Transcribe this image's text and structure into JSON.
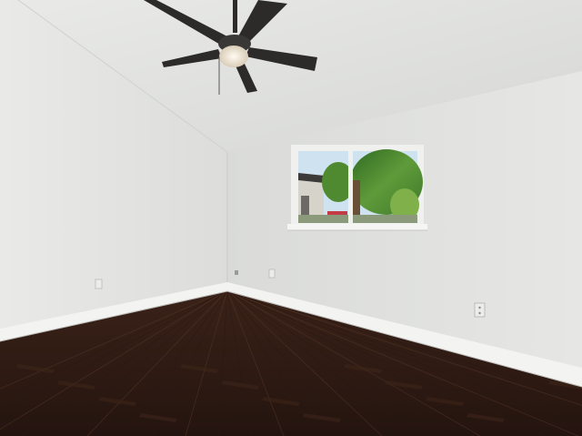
{
  "scene": {
    "subject": "empty-room",
    "colors": {
      "ceiling": "#e3e4e2",
      "ceiling_shadow": "#d4d5d3",
      "left_wall": "#e6e7e5",
      "back_wall": "#e1e2e0",
      "baseboard": "#f3f3f1",
      "floor_dark": "#2a1812",
      "floor_mid": "#3d2419",
      "floor_light": "#5a3827",
      "fan_blade": "#2d2b2a",
      "fan_light": "#f4ede0",
      "window_frame": "#f0f0ee",
      "foliage": "#3f7a2c",
      "foliage_light": "#7fb04a",
      "sky": "#cfe2ef",
      "outlet": "#ecece9"
    },
    "icons": [
      "ceiling-fan-icon",
      "window-icon",
      "outlet-icon"
    ]
  }
}
